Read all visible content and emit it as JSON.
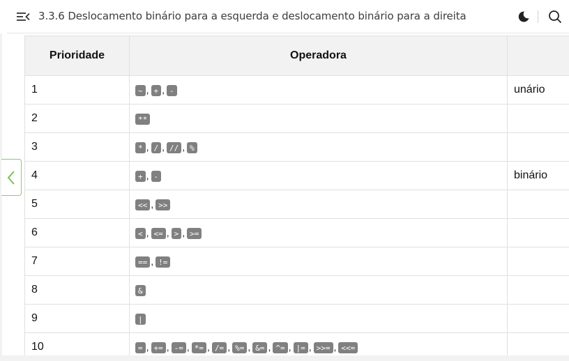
{
  "header": {
    "title": "3.3.6 Deslocamento binário para a esquerda e deslocamento binário para a direita",
    "menu_icon": "menu-collapse-icon",
    "theme_icon": "moon-icon",
    "search_icon": "search-icon"
  },
  "table": {
    "headers": [
      "Prioridade",
      "Operadora",
      ""
    ],
    "rows": [
      {
        "priority": "1",
        "ops": [
          "~",
          "+",
          "-"
        ],
        "type": "unário"
      },
      {
        "priority": "2",
        "ops": [
          "**"
        ],
        "type": ""
      },
      {
        "priority": "3",
        "ops": [
          "*",
          "/",
          "//",
          "%"
        ],
        "type": ""
      },
      {
        "priority": "4",
        "ops": [
          "+",
          "-"
        ],
        "type": "binário"
      },
      {
        "priority": "5",
        "ops": [
          "<<",
          ">>"
        ],
        "type": ""
      },
      {
        "priority": "6",
        "ops": [
          "<",
          "<=",
          ">",
          ">="
        ],
        "type": ""
      },
      {
        "priority": "7",
        "ops": [
          "==",
          "!="
        ],
        "type": ""
      },
      {
        "priority": "8",
        "ops": [
          "&"
        ],
        "type": ""
      },
      {
        "priority": "9",
        "ops": [
          "|"
        ],
        "type": ""
      },
      {
        "priority": "10",
        "ops": [
          "=",
          "+=",
          "-=",
          "*=",
          "/=",
          "%=",
          "&=",
          "^=",
          "|=",
          ">>=",
          "<<="
        ],
        "type": ""
      }
    ]
  },
  "colors": {
    "accent": "#8cc96a",
    "code_bg": "#808080",
    "header_bg": "#f2f2f2"
  }
}
